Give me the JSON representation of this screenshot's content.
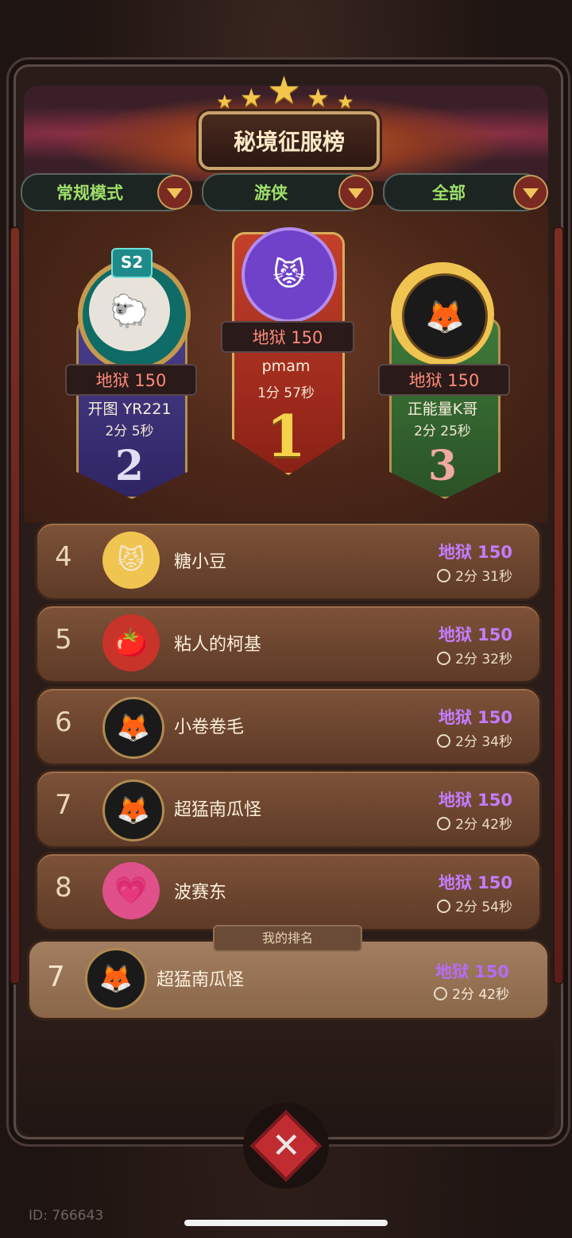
{
  "title": "秘境征服榜",
  "filters": [
    {
      "label": "常规模式"
    },
    {
      "label": "游侠"
    },
    {
      "label": "全部"
    }
  ],
  "top3": [
    {
      "rank": "1",
      "tier": "地狱 150",
      "name": "pmam",
      "time": "1分 57秒"
    },
    {
      "rank": "2",
      "tier": "地狱 150",
      "name": "开图 YR221",
      "time": "2分 5秒",
      "badge": "S2"
    },
    {
      "rank": "3",
      "tier": "地狱 150",
      "name": "正能量K哥",
      "time": "2分 25秒"
    }
  ],
  "rows": [
    {
      "rank": "4",
      "name": "糖小豆",
      "tier": "地狱 150",
      "time": "2分 31秒"
    },
    {
      "rank": "5",
      "name": "粘人的柯基",
      "tier": "地狱 150",
      "time": "2分 32秒"
    },
    {
      "rank": "6",
      "name": "小卷卷毛",
      "tier": "地狱 150",
      "time": "2分 34秒"
    },
    {
      "rank": "7",
      "name": "超猛南瓜怪",
      "tier": "地狱 150",
      "time": "2分 42秒"
    },
    {
      "rank": "8",
      "name": "波赛东",
      "tier": "地狱 150",
      "time": "2分 54秒"
    }
  ],
  "my_rank": {
    "tag": "我的排名",
    "rank": "7",
    "name": "超猛南瓜怪",
    "tier": "地狱 150",
    "time": "2分 42秒"
  },
  "footer_id": "ID: 766643",
  "colors": {
    "tier_purple": "#c47cff",
    "tier_red": "#ff8a7a",
    "filter_green": "#9fe06a",
    "gold": "#f2c54b"
  },
  "icons": [
    "chevron-down-icon",
    "clock-icon",
    "close-icon",
    "star-icon"
  ]
}
